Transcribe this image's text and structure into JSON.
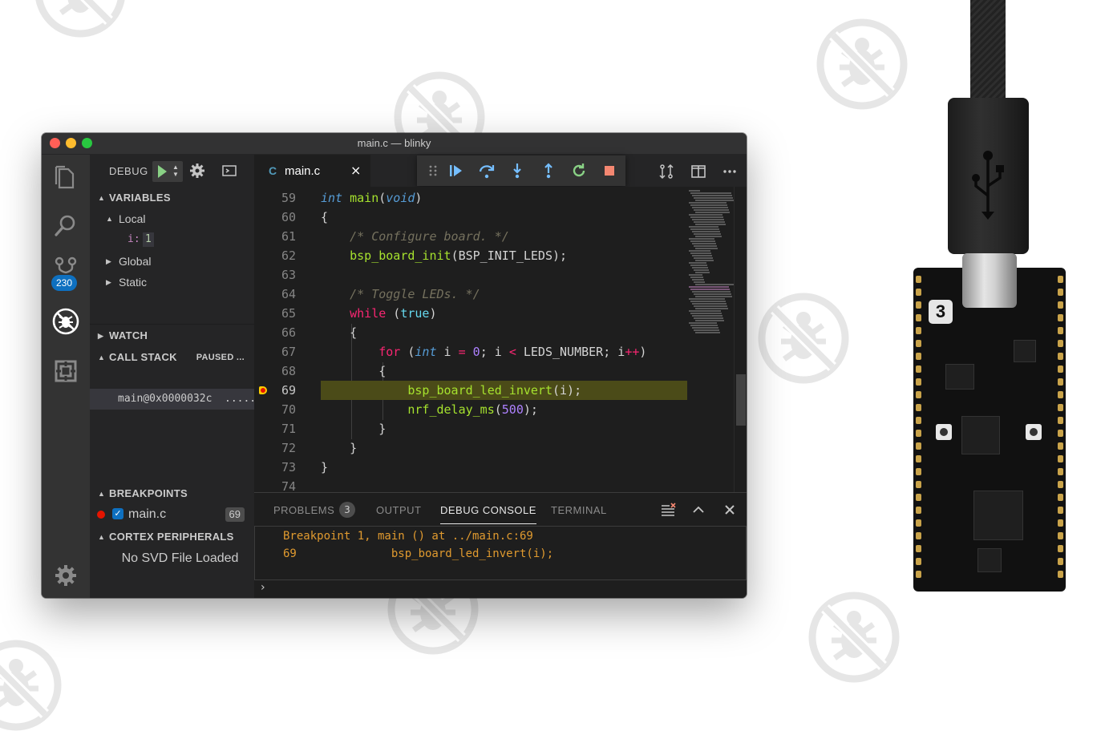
{
  "window": {
    "title": "main.c — blinky"
  },
  "activity": {
    "badge": "230"
  },
  "sidebar": {
    "debug_label": "DEBUG",
    "variables": {
      "title": "VARIABLES",
      "local": "Local",
      "var_name": "i:",
      "var_value": "1",
      "global": "Global",
      "static": "Static"
    },
    "watch": {
      "title": "WATCH"
    },
    "call_stack": {
      "title": "CALL STACK",
      "status": "PAUSED ...",
      "frame": "main@0x0000032c",
      "frame_more": "....."
    },
    "breakpoints": {
      "title": "BREAKPOINTS",
      "file": "main.c",
      "line": "69"
    },
    "peripherals": {
      "title": "CORTEX PERIPHERALS",
      "message": "No SVD File Loaded"
    }
  },
  "editor": {
    "tab": {
      "lang": "C",
      "filename": "main.c",
      "close": "×"
    },
    "lines": [
      {
        "n": "59",
        "parts": [
          [
            "k-type",
            "int"
          ],
          [
            "",
            " "
          ],
          [
            "k-fn2",
            "main"
          ],
          [
            "",
            "("
          ],
          [
            "k-type",
            "void"
          ],
          [
            "",
            ")"
          ]
        ]
      },
      {
        "n": "60",
        "parts": [
          [
            "",
            "{"
          ]
        ]
      },
      {
        "n": "61",
        "parts": [
          [
            "",
            "    "
          ],
          [
            "k-cmt",
            "/* Configure board. */"
          ]
        ]
      },
      {
        "n": "62",
        "parts": [
          [
            "",
            "    "
          ],
          [
            "k-fn2",
            "bsp_board_init"
          ],
          [
            "",
            "(BSP_INIT_LEDS);"
          ]
        ]
      },
      {
        "n": "63",
        "parts": []
      },
      {
        "n": "64",
        "parts": [
          [
            "",
            "    "
          ],
          [
            "k-cmt",
            "/* Toggle LEDs. */"
          ]
        ]
      },
      {
        "n": "65",
        "parts": [
          [
            "",
            "    "
          ],
          [
            "k-op",
            "while"
          ],
          [
            "",
            " ("
          ],
          [
            "k-bool",
            "true"
          ],
          [
            "",
            ")"
          ]
        ]
      },
      {
        "n": "66",
        "parts": [
          [
            "",
            "    {"
          ]
        ]
      },
      {
        "n": "67",
        "parts": [
          [
            "",
            "        "
          ],
          [
            "k-op",
            "for"
          ],
          [
            "",
            " ("
          ],
          [
            "k-type",
            "int"
          ],
          [
            "",
            " i "
          ],
          [
            "k-op",
            "="
          ],
          [
            "",
            " "
          ],
          [
            "k-num",
            "0"
          ],
          [
            "",
            "; i "
          ],
          [
            "k-op",
            "<"
          ],
          [
            "",
            " LEDS_NUMBER; i"
          ],
          [
            "k-op",
            "++"
          ],
          [
            "",
            ")"
          ]
        ]
      },
      {
        "n": "68",
        "parts": [
          [
            "",
            "        {"
          ]
        ]
      },
      {
        "n": "69",
        "parts": [
          [
            "",
            "            "
          ],
          [
            "k-fn2",
            "bsp_board_led_invert"
          ],
          [
            "",
            "(i);"
          ]
        ]
      },
      {
        "n": "70",
        "parts": [
          [
            "",
            "            "
          ],
          [
            "k-fn2",
            "nrf_delay_ms"
          ],
          [
            "",
            "("
          ],
          [
            "k-num",
            "500"
          ],
          [
            "",
            ");"
          ]
        ]
      },
      {
        "n": "71",
        "parts": [
          [
            "",
            "        }"
          ]
        ]
      },
      {
        "n": "72",
        "parts": [
          [
            "",
            "    }"
          ]
        ]
      },
      {
        "n": "73",
        "parts": [
          [
            "",
            "}"
          ]
        ]
      },
      {
        "n": "74",
        "parts": []
      }
    ],
    "current_line": "69"
  },
  "panel": {
    "tabs": [
      "PROBLEMS",
      "OUTPUT",
      "DEBUG CONSOLE",
      "TERMINAL"
    ],
    "problems_count": "3",
    "console": [
      "Breakpoint 1, main () at ../main.c:69",
      "69              bsp_board_led_invert(i);"
    ],
    "prompt": "›"
  },
  "icons": {
    "activity": [
      "files-icon",
      "search-icon",
      "source-control-icon",
      "debug-icon",
      "extensions-icon",
      "settings-gear-icon"
    ],
    "debug_toolbar": [
      "drag-handle-icon",
      "continue-icon",
      "step-over-icon",
      "step-into-icon",
      "step-out-icon",
      "restart-icon",
      "stop-icon"
    ]
  },
  "colors": {
    "accent": "#0e70c0",
    "highlight": "#4b4b18",
    "breakpoint": "#e51400",
    "console": "#e09a2f"
  },
  "board": {
    "logo": "3"
  }
}
